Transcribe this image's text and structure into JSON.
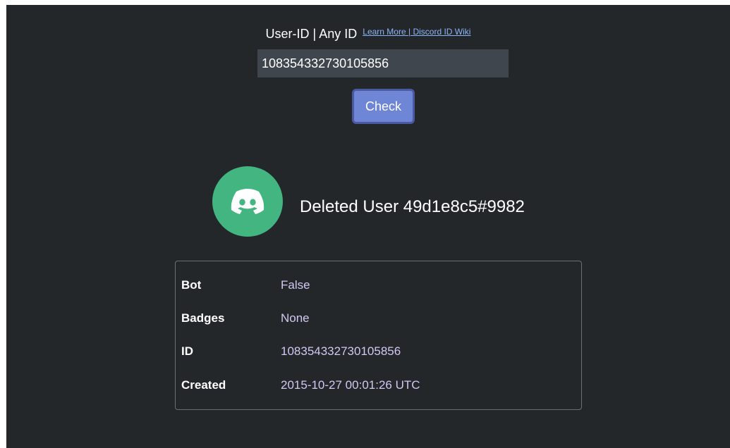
{
  "header": {
    "label": "User-ID | Any ID",
    "learn_more": "Learn More",
    "separator": " | ",
    "wiki": "Discord ID Wiki"
  },
  "search": {
    "value": "108354332730105856",
    "button_label": "Check"
  },
  "profile": {
    "avatar_icon": "discord-logo-icon",
    "avatar_color": "#43b581",
    "username": "Deleted User 49d1e8c5#9982"
  },
  "details": [
    {
      "key": "Bot",
      "value": "False"
    },
    {
      "key": "Badges",
      "value": "None"
    },
    {
      "key": "ID",
      "value": "108354332730105856"
    },
    {
      "key": "Created",
      "value": "2015-10-27 00:01:26 UTC"
    }
  ],
  "colors": {
    "background": "#23272a",
    "accent": "#6f85d6",
    "value_text": "#d3c8f2",
    "link": "#8ab4f8"
  }
}
